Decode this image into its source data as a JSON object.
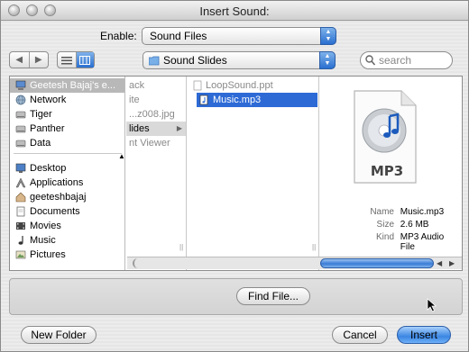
{
  "window": {
    "title": "Insert Sound:"
  },
  "enable": {
    "label": "Enable:",
    "value": "Sound Files"
  },
  "toolbar": {
    "location": "Sound Slides",
    "search_placeholder": "search"
  },
  "sidebar": {
    "items": [
      {
        "label": "Geetesh Bajaj's e...",
        "icon": "computer-icon"
      },
      {
        "label": "Network",
        "icon": "globe-icon"
      },
      {
        "label": "Tiger",
        "icon": "disk-icon"
      },
      {
        "label": "Panther",
        "icon": "disk-icon"
      },
      {
        "label": "Data",
        "icon": "disk-icon"
      },
      {
        "label": "Desktop",
        "icon": "desktop-icon"
      },
      {
        "label": "Applications",
        "icon": "applications-icon"
      },
      {
        "label": "geeteshbajaj",
        "icon": "home-icon"
      },
      {
        "label": "Documents",
        "icon": "documents-icon"
      },
      {
        "label": "Movies",
        "icon": "movies-icon"
      },
      {
        "label": "Music",
        "icon": "music-icon"
      },
      {
        "label": "Pictures",
        "icon": "pictures-icon"
      }
    ]
  },
  "columns": {
    "col1": [
      "ack",
      "ite",
      "...z008.jpg",
      "lides",
      "nt Viewer"
    ],
    "col2": [
      "LoopSound.ppt",
      "Music.mp3"
    ]
  },
  "preview": {
    "badge": "MP3",
    "info": [
      {
        "key": "Name",
        "value": "Music.mp3"
      },
      {
        "key": "Size",
        "value": "2.6 MB"
      },
      {
        "key": "Kind",
        "value": "MP3 Audio File"
      }
    ]
  },
  "buttons": {
    "find_file": "Find File...",
    "new_folder": "New Folder",
    "cancel": "Cancel",
    "insert": "Insert"
  },
  "colors": {
    "selection": "#2d6ad6",
    "sidebar_selection": "#b8b8b8",
    "default_button": "#3b86e3"
  }
}
